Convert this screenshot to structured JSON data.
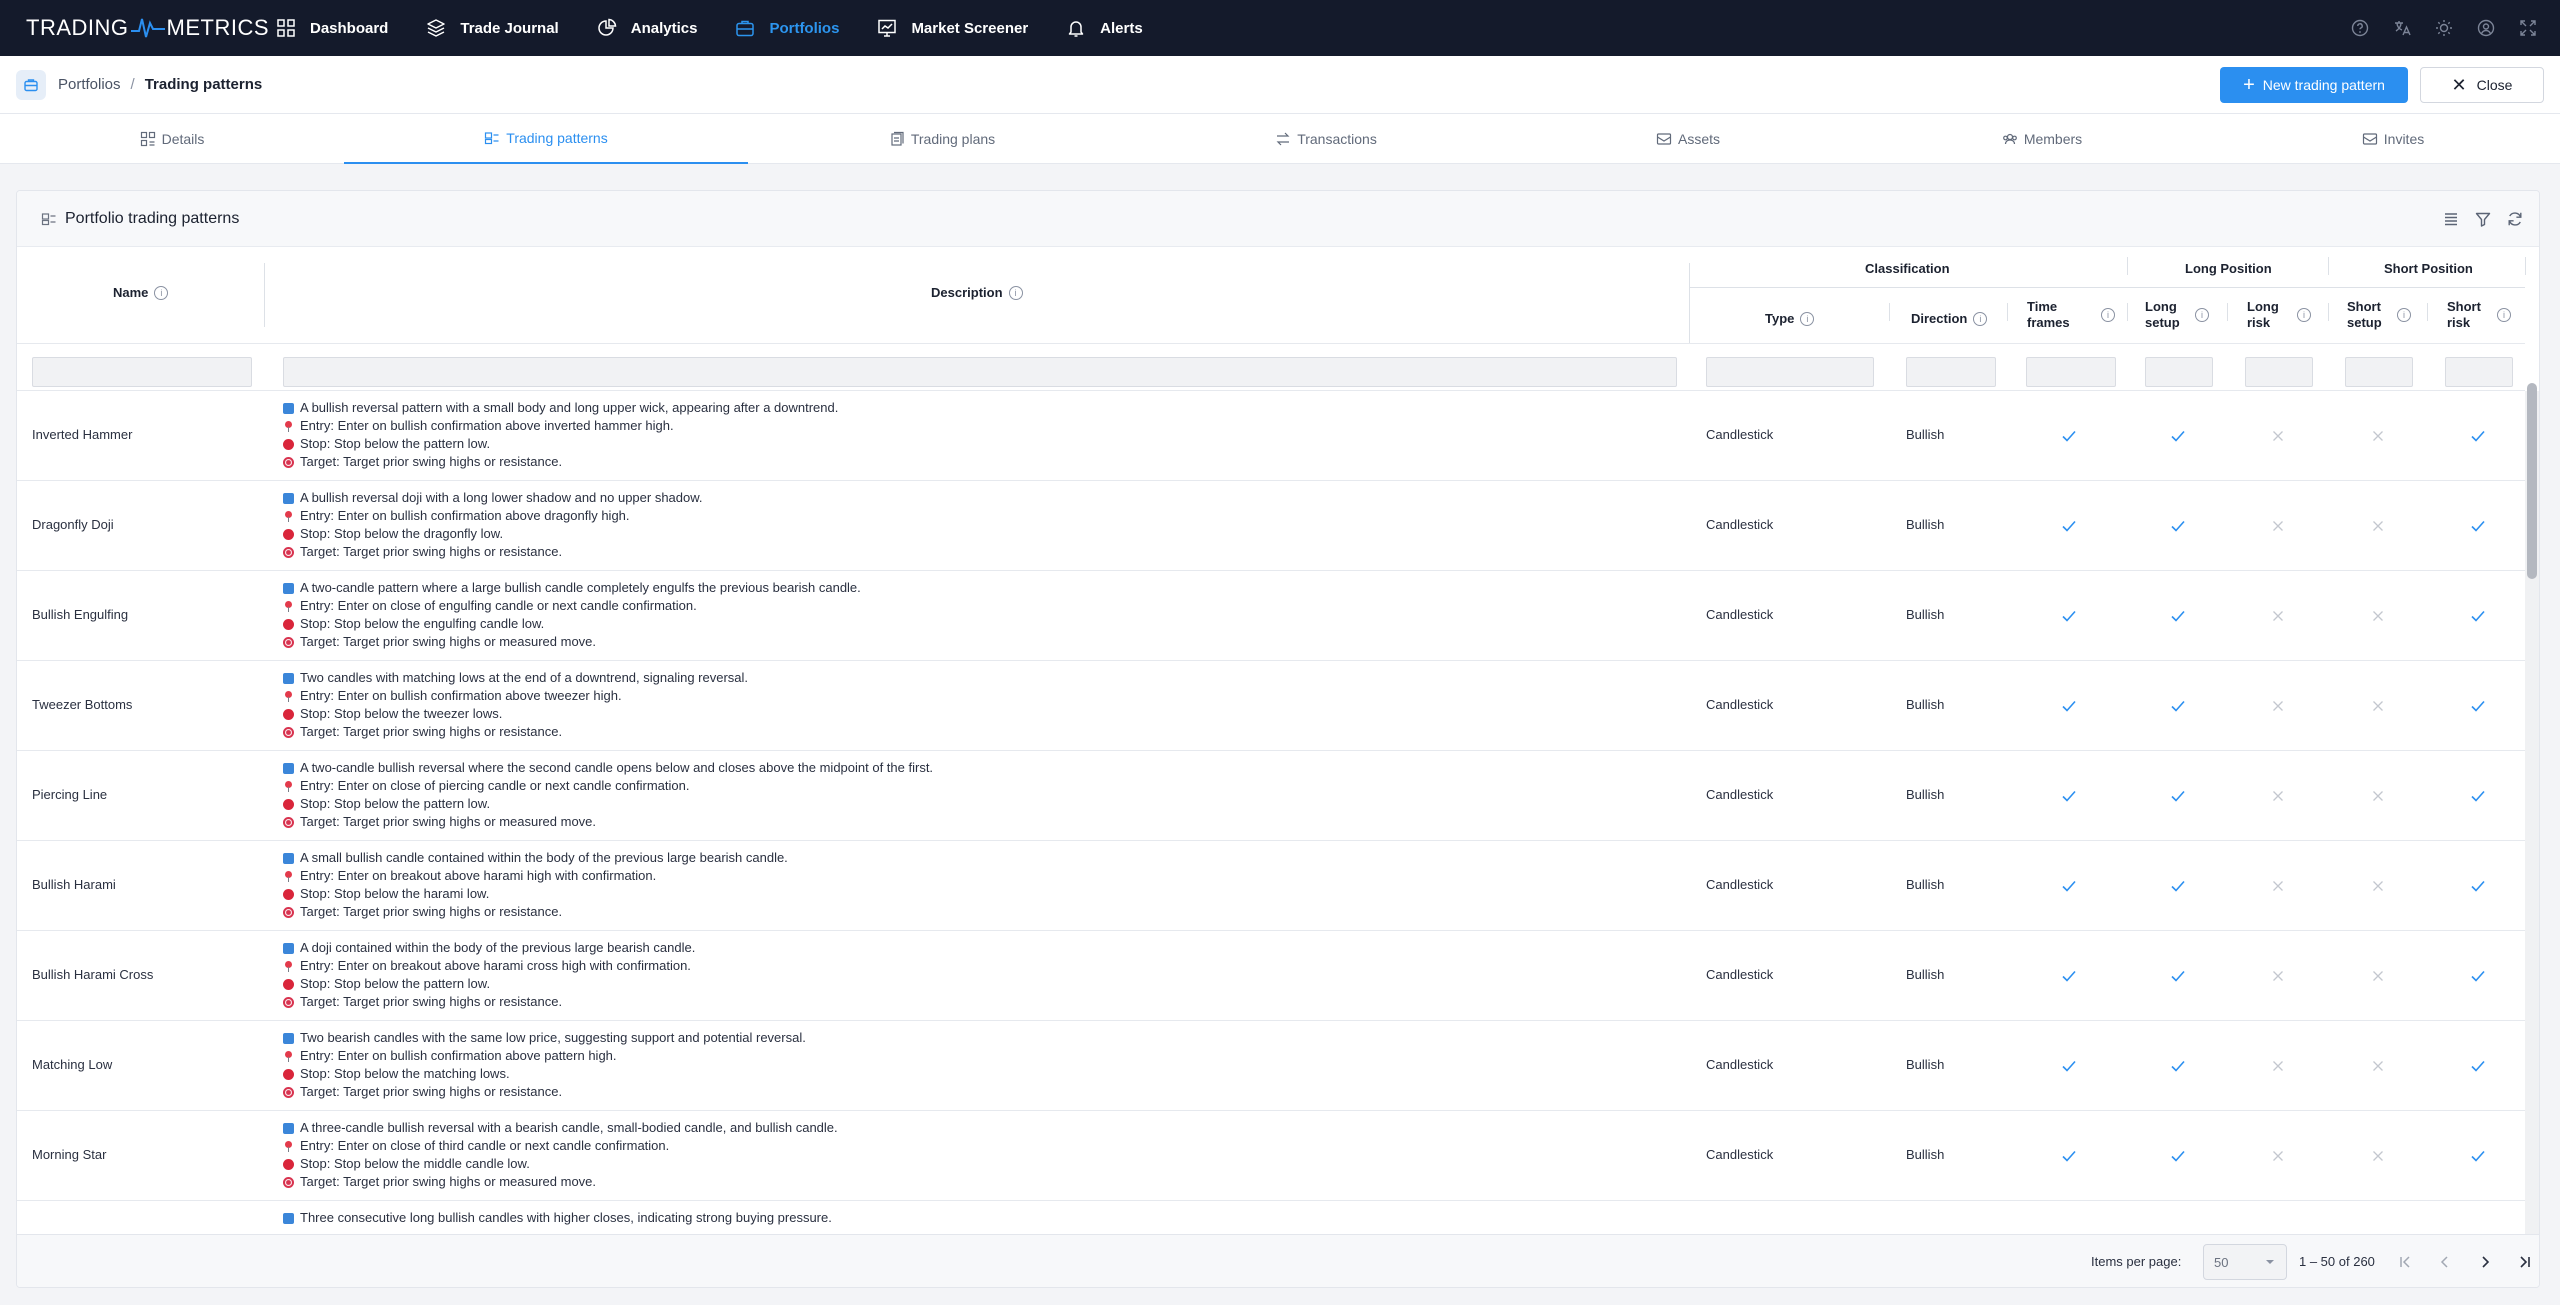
{
  "app": {
    "logo_left": "TRADING",
    "logo_right": "METRICS",
    "nav": [
      {
        "label": "Dashboard",
        "icon": "dashboard-icon",
        "active": false
      },
      {
        "label": "Trade Journal",
        "icon": "layers-icon",
        "active": false
      },
      {
        "label": "Analytics",
        "icon": "pie-chart-icon",
        "active": false
      },
      {
        "label": "Portfolios",
        "icon": "briefcase-icon",
        "active": true
      },
      {
        "label": "Market Screener",
        "icon": "screener-icon",
        "active": false
      },
      {
        "label": "Alerts",
        "icon": "bell-icon",
        "active": false
      }
    ],
    "right_icons": [
      "help-icon",
      "translate-icon",
      "theme-icon",
      "account-icon",
      "fullscreen-icon"
    ]
  },
  "breadcrumb": {
    "parent": "Portfolios",
    "separator": "/",
    "current": "Trading patterns"
  },
  "actions": {
    "new_label": "New trading pattern",
    "close_label": "Close"
  },
  "tabs": [
    {
      "label": "Details",
      "active": false
    },
    {
      "label": "Trading patterns",
      "active": true
    },
    {
      "label": "Trading plans",
      "active": false
    },
    {
      "label": "Transactions",
      "active": false
    },
    {
      "label": "Assets",
      "active": false
    },
    {
      "label": "Members",
      "active": false
    },
    {
      "label": "Invites",
      "active": false
    }
  ],
  "card": {
    "title": "Portfolio trading patterns"
  },
  "columns": {
    "name": "Name",
    "description": "Description",
    "group_classification": "Classification",
    "group_long": "Long Position",
    "group_short": "Short Position",
    "type": "Type",
    "direction": "Direction",
    "time_frames": [
      "Time",
      "frames"
    ],
    "long_setup": [
      "Long",
      "setup"
    ],
    "long_risk": [
      "Long",
      "risk"
    ],
    "short_setup": [
      "Short",
      "setup"
    ],
    "short_risk": [
      "Short",
      "risk"
    ]
  },
  "rows": [
    {
      "name": "Inverted Hammer",
      "desc": [
        "A bullish reversal pattern with a small body and long upper wick, appearing after a downtrend.",
        "Entry: Enter on bullish confirmation above inverted hammer high.",
        "Stop: Stop below the pattern low.",
        "Target: Target prior swing highs or resistance."
      ],
      "type": "Candlestick",
      "direction": "Bullish",
      "flags": [
        true,
        true,
        false,
        false,
        true
      ]
    },
    {
      "name": "Dragonfly Doji",
      "desc": [
        "A bullish reversal doji with a long lower shadow and no upper shadow.",
        "Entry: Enter on bullish confirmation above dragonfly high.",
        "Stop: Stop below the dragonfly low.",
        "Target: Target prior swing highs or resistance."
      ],
      "type": "Candlestick",
      "direction": "Bullish",
      "flags": [
        true,
        true,
        false,
        false,
        true
      ]
    },
    {
      "name": "Bullish Engulfing",
      "desc": [
        "A two-candle pattern where a large bullish candle completely engulfs the previous bearish candle.",
        "Entry: Enter on close of engulfing candle or next candle confirmation.",
        "Stop: Stop below the engulfing candle low.",
        "Target: Target prior swing highs or measured move."
      ],
      "type": "Candlestick",
      "direction": "Bullish",
      "flags": [
        true,
        true,
        false,
        false,
        true
      ]
    },
    {
      "name": "Tweezer Bottoms",
      "desc": [
        "Two candles with matching lows at the end of a downtrend, signaling reversal.",
        "Entry: Enter on bullish confirmation above tweezer high.",
        "Stop: Stop below the tweezer lows.",
        "Target: Target prior swing highs or resistance."
      ],
      "type": "Candlestick",
      "direction": "Bullish",
      "flags": [
        true,
        true,
        false,
        false,
        true
      ]
    },
    {
      "name": "Piercing Line",
      "desc": [
        "A two-candle bullish reversal where the second candle opens below and closes above the midpoint of the first.",
        "Entry: Enter on close of piercing candle or next candle confirmation.",
        "Stop: Stop below the pattern low.",
        "Target: Target prior swing highs or measured move."
      ],
      "type": "Candlestick",
      "direction": "Bullish",
      "flags": [
        true,
        true,
        false,
        false,
        true
      ]
    },
    {
      "name": "Bullish Harami",
      "desc": [
        "A small bullish candle contained within the body of the previous large bearish candle.",
        "Entry: Enter on breakout above harami high with confirmation.",
        "Stop: Stop below the harami low.",
        "Target: Target prior swing highs or resistance."
      ],
      "type": "Candlestick",
      "direction": "Bullish",
      "flags": [
        true,
        true,
        false,
        false,
        true
      ]
    },
    {
      "name": "Bullish Harami Cross",
      "desc": [
        "A doji contained within the body of the previous large bearish candle.",
        "Entry: Enter on breakout above harami cross high with confirmation.",
        "Stop: Stop below the pattern low.",
        "Target: Target prior swing highs or resistance."
      ],
      "type": "Candlestick",
      "direction": "Bullish",
      "flags": [
        true,
        true,
        false,
        false,
        true
      ]
    },
    {
      "name": "Matching Low",
      "desc": [
        "Two bearish candles with the same low price, suggesting support and potential reversal.",
        "Entry: Enter on bullish confirmation above pattern high.",
        "Stop: Stop below the matching lows.",
        "Target: Target prior swing highs or resistance."
      ],
      "type": "Candlestick",
      "direction": "Bullish",
      "flags": [
        true,
        true,
        false,
        false,
        true
      ]
    },
    {
      "name": "Morning Star",
      "desc": [
        "A three-candle bullish reversal with a bearish candle, small-bodied candle, and bullish candle.",
        "Entry: Enter on close of third candle or next candle confirmation.",
        "Stop: Stop below the middle candle low.",
        "Target: Target prior swing highs or measured move."
      ],
      "type": "Candlestick",
      "direction": "Bullish",
      "flags": [
        true,
        true,
        false,
        false,
        true
      ]
    },
    {
      "name": "",
      "desc": [
        "Three consecutive long bullish candles with higher closes, indicating strong buying pressure.",
        "",
        "",
        ""
      ],
      "type": "",
      "direction": "",
      "flags": [
        null,
        null,
        null,
        null,
        null
      ]
    }
  ],
  "pagination": {
    "items_label": "Items per page:",
    "per_page": "50",
    "range": "1 – 50 of 260"
  },
  "colors": {
    "nav_bg": "#141a2b",
    "accent": "#2b8ff0",
    "check": "#2b8ff0",
    "cross": "#c3c7cf"
  }
}
